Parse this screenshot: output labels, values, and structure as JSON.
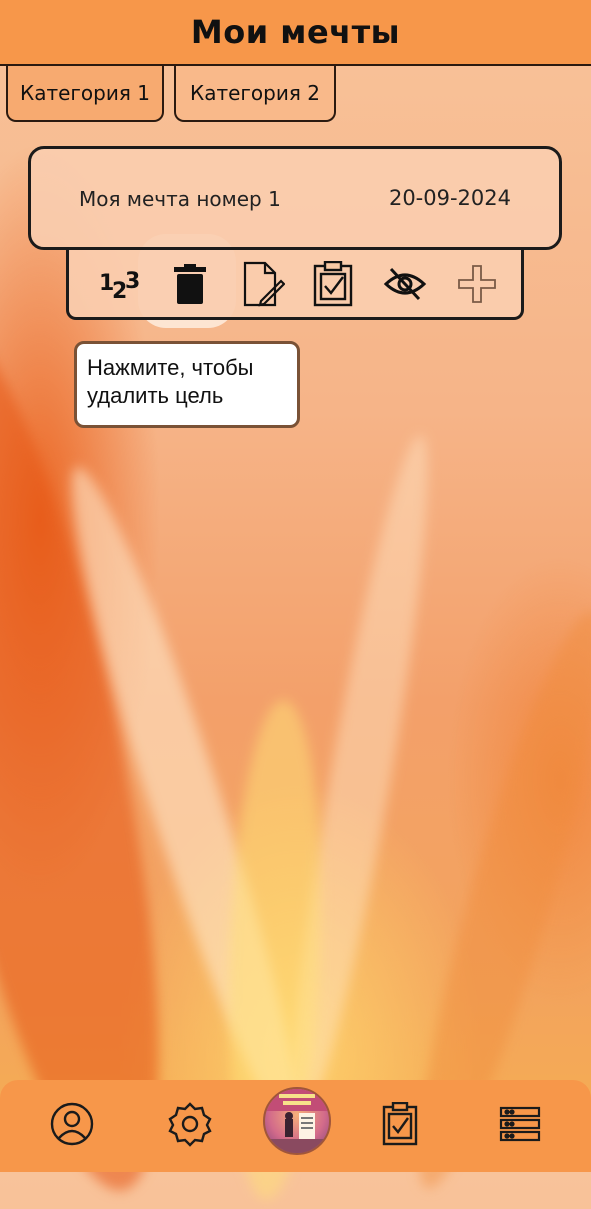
{
  "header": {
    "title": "Мои мечты"
  },
  "tabs": [
    {
      "label": "Категория 1"
    },
    {
      "label": "Категория 2"
    }
  ],
  "dream_card": {
    "name": "Моя мечта номер 1",
    "date": "20-09-2024"
  },
  "toolbar": {
    "numbering_label": "123",
    "icons": [
      "numbering-icon",
      "trash-icon",
      "edit-document-icon",
      "clipboard-check-icon",
      "eye-slash-icon",
      "plus-icon"
    ]
  },
  "tooltip": {
    "text": "Нажмите, чтобы удалить цель"
  },
  "bottom_nav": {
    "items": [
      "profile-icon",
      "settings-icon",
      "avatar",
      "clipboard-check-icon",
      "list-icon"
    ]
  },
  "colors": {
    "header_bg": "#f7974a",
    "tooltip_border": "#7a5236",
    "outline": "#1b1b1b"
  }
}
